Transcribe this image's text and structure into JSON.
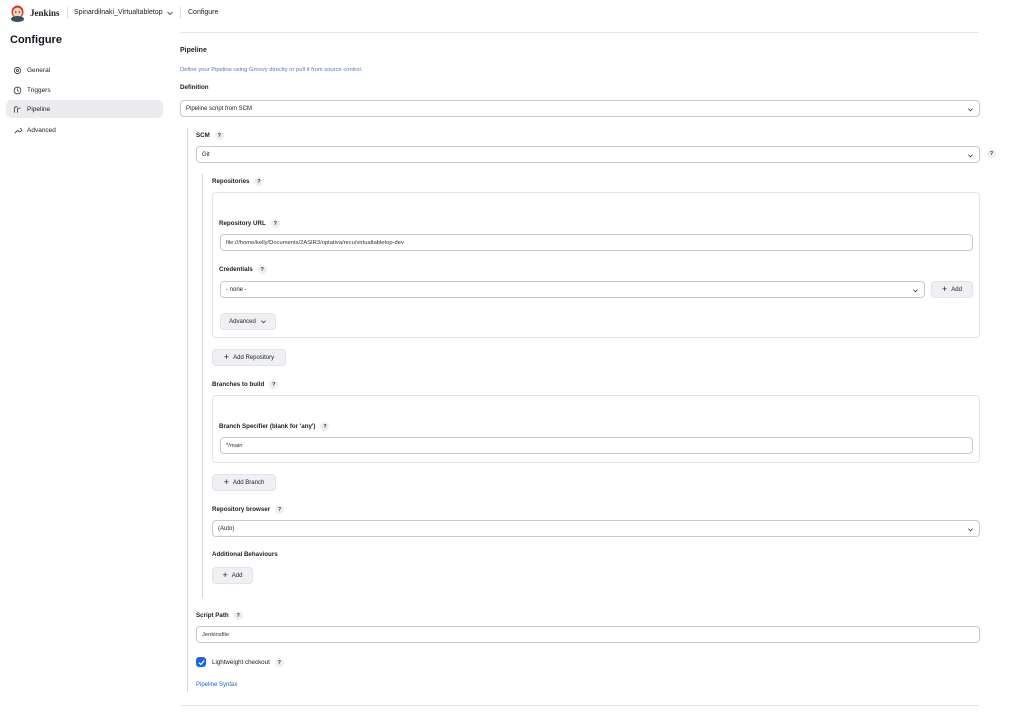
{
  "header": {
    "brand": "Jenkins",
    "breadcrumbs": [
      "Spinardilnaki_Virtualtabletop",
      "Configure"
    ]
  },
  "sidebar": {
    "title": "Configure",
    "items": [
      {
        "label": "General",
        "icon": "gear-icon"
      },
      {
        "label": "Triggers",
        "icon": "clock-icon"
      },
      {
        "label": "Pipeline",
        "icon": "pipeline-icon",
        "active": true
      },
      {
        "label": "Advanced",
        "icon": "wrench-icon"
      }
    ]
  },
  "pipeline": {
    "title": "Pipeline",
    "description": "Define your Pipeline using Groovy directly or pull it from source control.",
    "definition_label": "Definition",
    "definition_value": "Pipeline script from SCM",
    "scm_label": "SCM",
    "scm_value": "Git",
    "repositories_label": "Repositories",
    "repo_url_label": "Repository URL",
    "repo_url_value": "file:///home/kelly/Documents/2ASIR3/optativa/recu/virtualtabletop-dev",
    "credentials_label": "Credentials",
    "credentials_value": "- none -",
    "add_label": "Add",
    "advanced_label": "Advanced",
    "add_repository_label": "Add Repository",
    "branches_label": "Branches to build",
    "branch_specifier_label": "Branch Specifier (blank for 'any')",
    "branch_specifier_value": "*/main",
    "add_branch_label": "Add Branch",
    "repo_browser_label": "Repository browser",
    "repo_browser_value": "(Auto)",
    "additional_behaviours_label": "Additional Behaviours",
    "add_behaviour_label": "Add",
    "script_path_label": "Script Path",
    "script_path_value": "Jenkinsfile",
    "lightweight_label": "Lightweight checkout",
    "lightweight_checked": true,
    "syntax_link": "Pipeline Syntax"
  },
  "help_glyph": "?",
  "colors": {
    "accent": "#1a66e0",
    "link_desc": "#5b7aa8",
    "active_bg": "#ebebf0"
  }
}
